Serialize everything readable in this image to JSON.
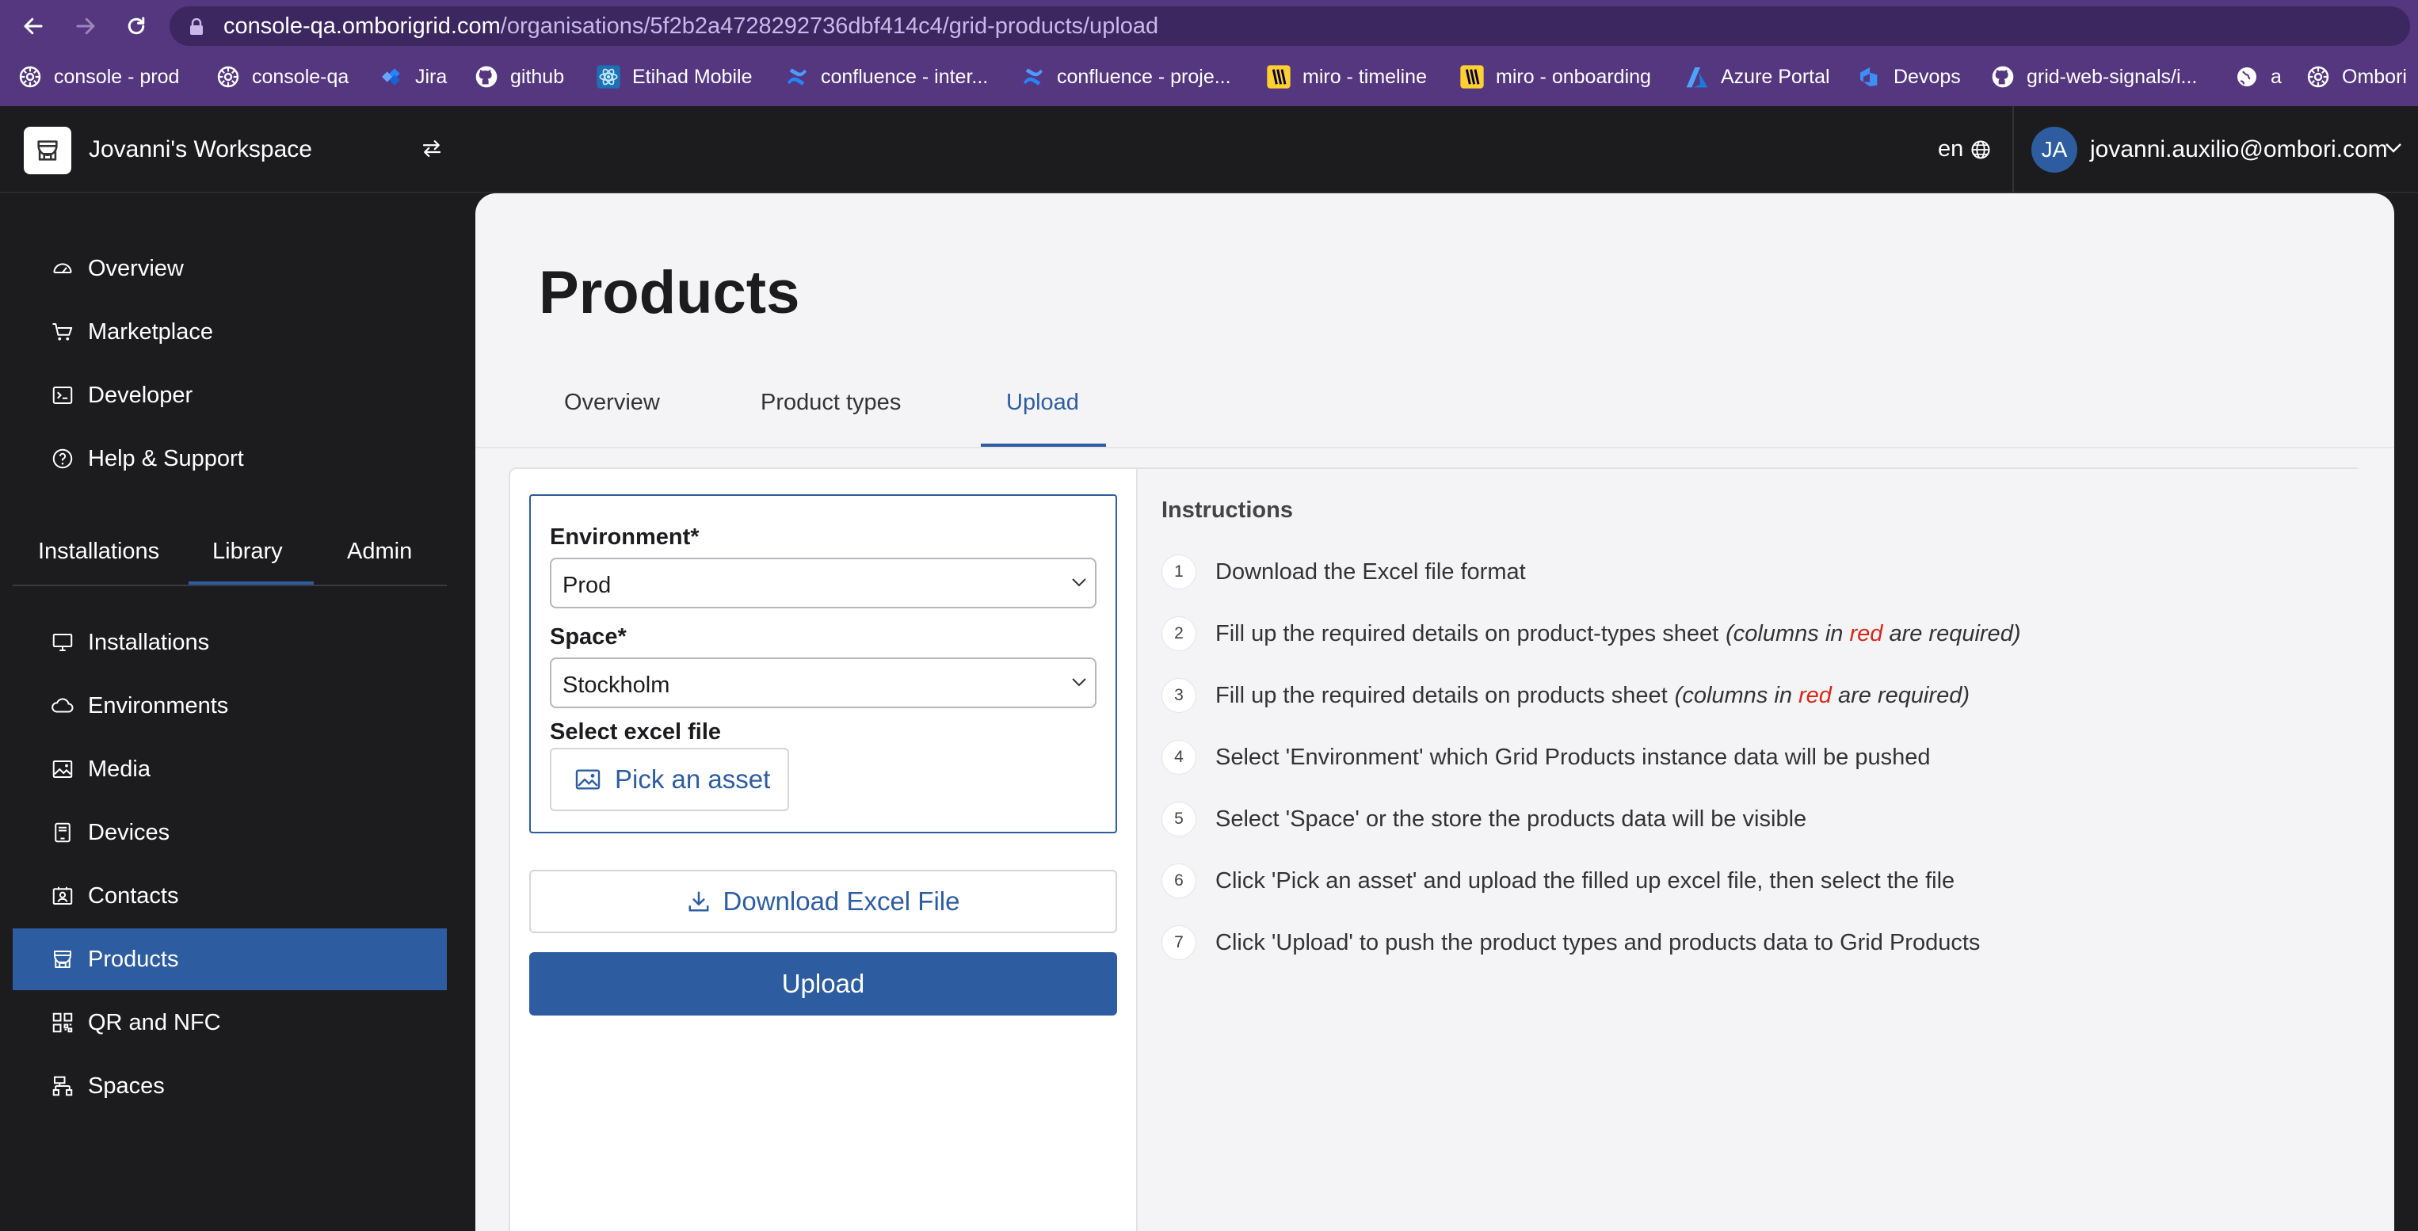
{
  "browser": {
    "url_host": "console-qa.omborigrid.com",
    "url_path": "/organisations/5f2b2a4728292736dbf414c4/grid-products/upload",
    "bookmarks": [
      {
        "label": "console - prod",
        "icon": "gear-icon"
      },
      {
        "label": "console-qa",
        "icon": "gear-icon"
      },
      {
        "label": "Jira",
        "icon": "jira-icon"
      },
      {
        "label": "github",
        "icon": "github-icon"
      },
      {
        "label": "Etihad Mobile",
        "icon": "react-icon"
      },
      {
        "label": "confluence - inter...",
        "icon": "confluence-icon"
      },
      {
        "label": "confluence - proje...",
        "icon": "confluence-icon"
      },
      {
        "label": "miro - timeline",
        "icon": "miro-icon"
      },
      {
        "label": "miro - onboarding",
        "icon": "miro-icon"
      },
      {
        "label": "Azure Portal",
        "icon": "azure-icon"
      },
      {
        "label": "Devops",
        "icon": "devops-icon"
      },
      {
        "label": "grid-web-signals/i...",
        "icon": "github-icon"
      },
      {
        "label": "a",
        "icon": "globe-icon"
      },
      {
        "label": "Ombori",
        "icon": "gear-icon"
      }
    ]
  },
  "header": {
    "workspace_name": "Jovanni's Workspace",
    "language": "en",
    "user_initials": "JA",
    "user_email": "jovanni.auxilio@ombori.com"
  },
  "sidebar": {
    "top_items": [
      {
        "label": "Overview",
        "icon": "dashboard-icon"
      },
      {
        "label": "Marketplace",
        "icon": "cart-icon"
      },
      {
        "label": "Developer",
        "icon": "terminal-icon"
      },
      {
        "label": "Help & Support",
        "icon": "help-icon"
      }
    ],
    "tabs": [
      "Installations",
      "Library",
      "Admin"
    ],
    "active_tab": "Library",
    "library_items": [
      {
        "label": "Installations",
        "icon": "monitor-icon"
      },
      {
        "label": "Environments",
        "icon": "cloud-icon"
      },
      {
        "label": "Media",
        "icon": "image-icon"
      },
      {
        "label": "Devices",
        "icon": "device-icon"
      },
      {
        "label": "Contacts",
        "icon": "contacts-icon"
      },
      {
        "label": "Products",
        "icon": "store-icon"
      },
      {
        "label": "QR and NFC",
        "icon": "qr-icon"
      },
      {
        "label": "Spaces",
        "icon": "spaces-icon"
      }
    ],
    "active_item": "Products"
  },
  "main": {
    "title": "Products",
    "tabs": [
      "Overview",
      "Product types",
      "Upload"
    ],
    "active_tab": "Upload",
    "form": {
      "environment_label": "Environment*",
      "environment_value": "Prod",
      "space_label": "Space*",
      "space_value": "Stockholm",
      "file_label": "Select excel file",
      "pick_button": "Pick an asset"
    },
    "download_button": "Download Excel File",
    "upload_button": "Upload",
    "instructions": {
      "title": "Instructions",
      "steps": [
        {
          "num": "1",
          "text": "Download the Excel file format"
        },
        {
          "num": "2",
          "text": "Fill up the required details on product-types sheet",
          "hint_pre": "(columns in ",
          "hint_red": "red",
          "hint_post": " are required)"
        },
        {
          "num": "3",
          "text": "Fill up the required details on products sheet",
          "hint_pre": "(columns in ",
          "hint_red": "red",
          "hint_post": " are required)"
        },
        {
          "num": "4",
          "text": "Select 'Environment' which Grid Products instance data will be pushed"
        },
        {
          "num": "5",
          "text": "Select 'Space' or the store the products data will be visible"
        },
        {
          "num": "6",
          "text": "Click 'Pick an asset' and upload the filled up excel file, then select the file"
        },
        {
          "num": "7",
          "text": "Click 'Upload' to push the product types and products data to Grid Products"
        }
      ]
    }
  },
  "colors": {
    "browser_chrome": "#55377f",
    "accent": "#2d5da0",
    "required_red": "#d5281b",
    "sidebar_bg": "#1c1c1e"
  }
}
